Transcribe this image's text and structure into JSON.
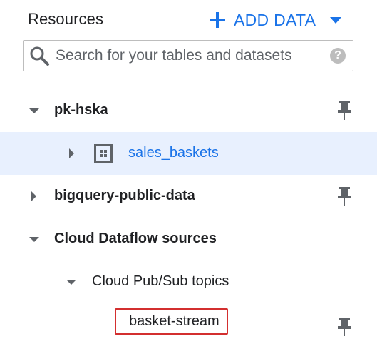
{
  "header": {
    "title": "Resources",
    "add_data_label": "ADD DATA",
    "add_icon": "plus-icon",
    "dropdown_icon": "caret-down-icon"
  },
  "search": {
    "placeholder": "Search for your tables and datasets",
    "value": "",
    "search_icon": "magnifier-icon",
    "help_icon": "help-circle-icon",
    "help_glyph": "?"
  },
  "tree": {
    "pk_hska": {
      "label": "pk-hska",
      "expanded": true,
      "pinned": true
    },
    "sales_baskets": {
      "label": "sales_baskets",
      "type": "dataset",
      "selected": true,
      "expanded": false
    },
    "bigquery_public_data": {
      "label": "bigquery-public-data",
      "expanded": false,
      "pinned": true
    },
    "cloud_dataflow_sources": {
      "label": "Cloud Dataflow sources",
      "expanded": true
    },
    "cloud_pubsub_topics": {
      "label": "Cloud Pub/Sub topics",
      "expanded": true
    },
    "basket_stream": {
      "label": "basket-stream",
      "pinned": true,
      "highlighted": true
    }
  },
  "colors": {
    "accent": "#1a73e8",
    "selected_row": "#e8f0fe",
    "highlight_border": "#d32f2f",
    "icon_gray": "#5f6368"
  }
}
